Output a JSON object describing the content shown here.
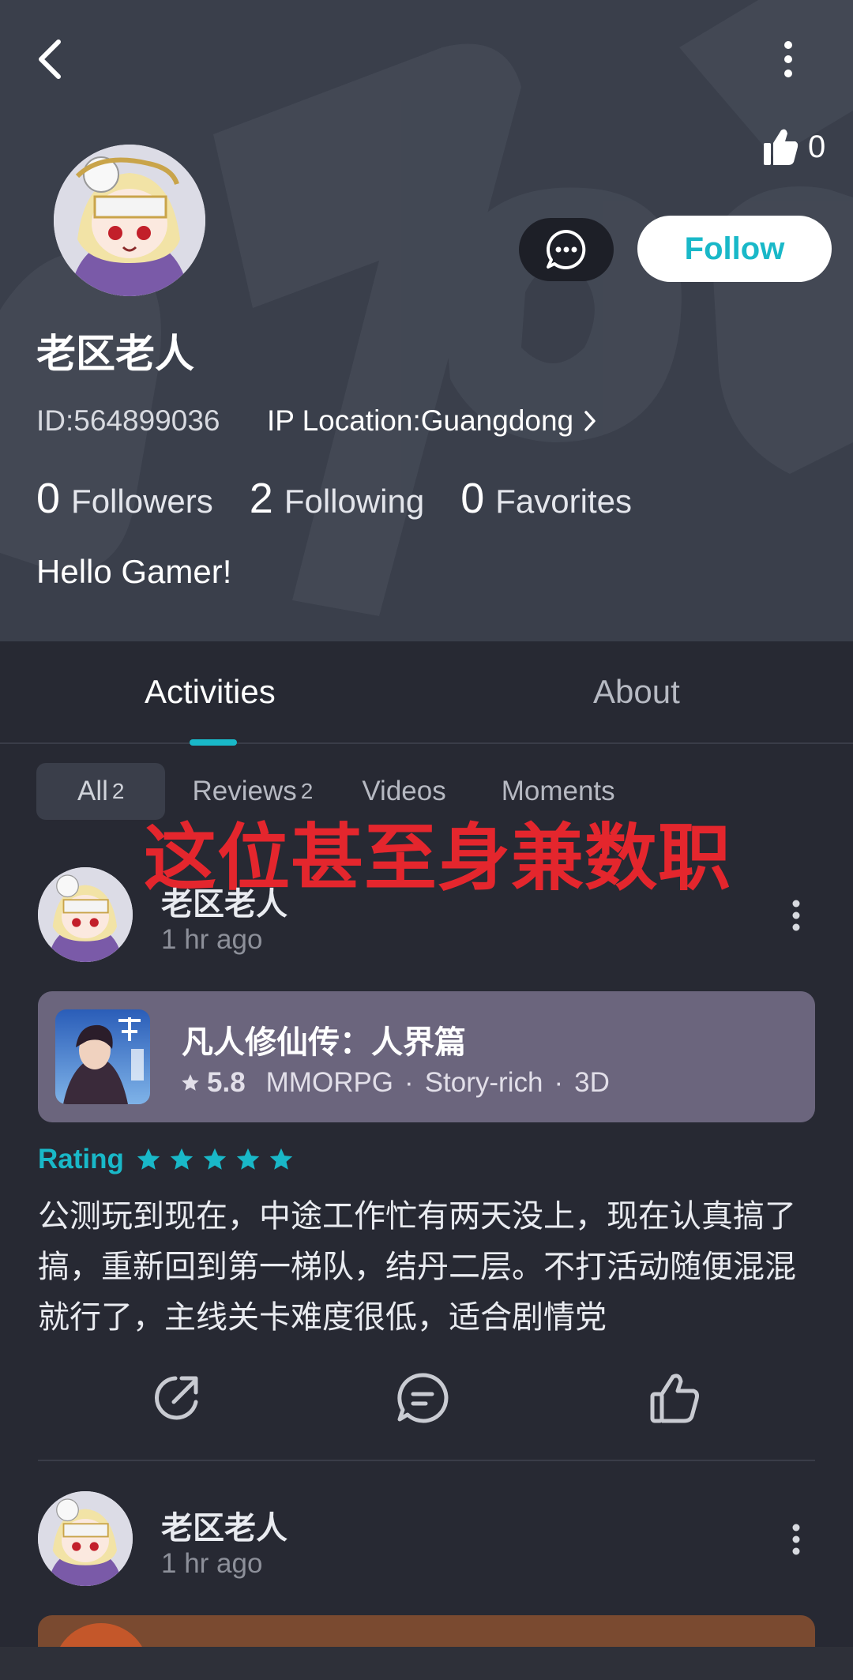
{
  "header": {
    "like_count": "0",
    "follow_label": "Follow",
    "username": "老区老人",
    "user_id": "ID:564899036",
    "ip_location": "IP Location:Guangdong",
    "stats": {
      "followers_num": "0",
      "followers_label": "Followers",
      "following_num": "2",
      "following_label": "Following",
      "favorites_num": "0",
      "favorites_label": "Favorites"
    },
    "bio": "Hello Gamer!"
  },
  "tabs": {
    "activities": "Activities",
    "about": "About"
  },
  "filters": {
    "all_label": "All",
    "all_count": "2",
    "reviews_label": "Reviews",
    "reviews_count": "2",
    "videos_label": "Videos",
    "moments_label": "Moments"
  },
  "overlay_caption": "这位甚至身兼数职",
  "posts": [
    {
      "author": "老区老人",
      "time": "1 hr ago",
      "game": {
        "title": "凡人修仙传：人界篇",
        "score": "5.8",
        "tags": [
          "MMORPG",
          "Story-rich",
          "3D"
        ]
      },
      "rating_label": "Rating",
      "rating_stars": 5,
      "text": "公测玩到现在，中途工作忙有两天没上，现在认真搞了搞，重新回到第一梯队，结丹二层。不打活动随便混混就行了，主线关卡难度很低，适合剧情党"
    },
    {
      "author": "老区老人",
      "time": "1 hr ago"
    }
  ],
  "colors": {
    "accent": "#19b8c8",
    "header_bg": "#3a3f4b",
    "body_bg": "#272933",
    "game_card_bg": "#6b657d",
    "overlay_text": "#e4262d"
  },
  "icons": [
    "back-arrow-icon",
    "more-vertical-icon",
    "thumbs-up-icon",
    "message-icon",
    "chevron-right-icon",
    "star-icon",
    "share-icon",
    "comment-icon",
    "like-icon"
  ]
}
